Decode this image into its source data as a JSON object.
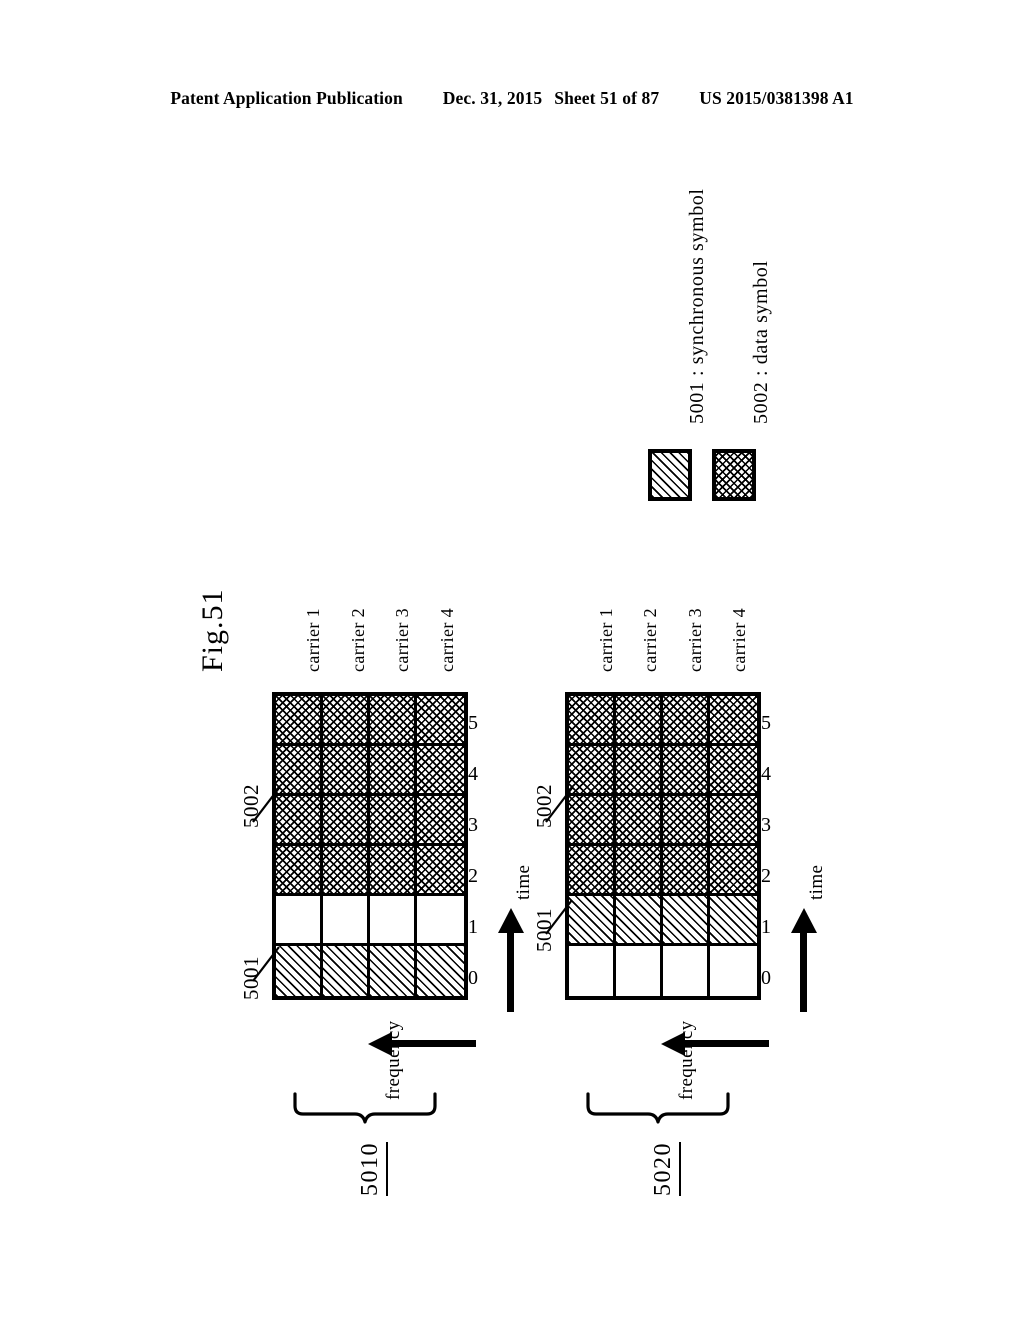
{
  "header": {
    "publication": "Patent Application Publication",
    "date": "Dec. 31, 2015",
    "sheet": "Sheet 51 of 87",
    "doc_number": "US 2015/0381398 A1"
  },
  "figure": {
    "label": "Fig.51"
  },
  "legend": {
    "items": [
      {
        "ref": "5001",
        "separator": ":",
        "text": "synchronous symbol",
        "full": "5001 : synchronous symbol",
        "pattern": "diagonal-hatch"
      },
      {
        "ref": "5002",
        "separator": ":",
        "text": "data symbol",
        "full": "5002 : data symbol",
        "pattern": "cross-hatch"
      }
    ]
  },
  "axes": {
    "time_label": "time",
    "frequency_label": "frequency",
    "time_ticks": [
      "0",
      "1",
      "2",
      "3",
      "4",
      "5"
    ]
  },
  "carriers": [
    "carrier 1",
    "carrier 2",
    "carrier 3",
    "carrier 4"
  ],
  "callouts": {
    "sync": "5001",
    "data": "5002"
  },
  "diagrams": [
    {
      "ref": "5010",
      "carriers": [
        "carrier 1",
        "carrier 2",
        "carrier 3",
        "carrier 4"
      ],
      "time_ticks": [
        "0",
        "1",
        "2",
        "3",
        "4",
        "5"
      ],
      "cell_patterns_by_time": [
        "diagonal-hatch",
        "empty",
        "cross-hatch",
        "cross-hatch",
        "cross-hatch",
        "cross-hatch"
      ],
      "callout_sync_time": "0",
      "callout_data_time": "3"
    },
    {
      "ref": "5020",
      "carriers": [
        "carrier 1",
        "carrier 2",
        "carrier 3",
        "carrier 4"
      ],
      "time_ticks": [
        "0",
        "1",
        "2",
        "3",
        "4",
        "5"
      ],
      "cell_patterns_by_time": [
        "empty",
        "diagonal-hatch",
        "cross-hatch",
        "cross-hatch",
        "cross-hatch",
        "cross-hatch"
      ],
      "callout_sync_time": "1",
      "callout_data_time": "3"
    }
  ]
}
